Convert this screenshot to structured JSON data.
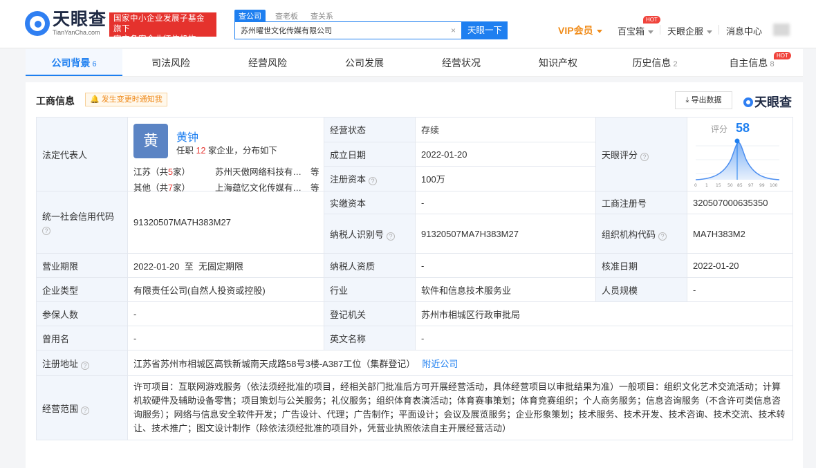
{
  "header": {
    "logo_text": "天眼查",
    "logo_sub": "TianYanCha.com",
    "badge_line1": "国家中小企业发展子基金旗下",
    "badge_line2": "官方备案企业征信机构",
    "search_tabs": [
      "查公司",
      "查老板",
      "查关系"
    ],
    "search_value": "苏州曜世文化传媒有限公司",
    "search_button": "天眼一下",
    "vip": "VIP会员",
    "baobao": "百宝箱",
    "hot": "HOT",
    "qiban": "天眼企服",
    "messages": "消息中心"
  },
  "tabs": [
    {
      "label": "公司背景",
      "count": "6"
    },
    {
      "label": "司法风险",
      "count": ""
    },
    {
      "label": "经营风险",
      "count": ""
    },
    {
      "label": "公司发展",
      "count": ""
    },
    {
      "label": "经营状况",
      "count": ""
    },
    {
      "label": "知识产权",
      "count": ""
    },
    {
      "label": "历史信息",
      "count": "2"
    },
    {
      "label": "自主信息",
      "count": "8"
    }
  ],
  "section": {
    "title": "工商信息",
    "notice": "发生变更时通知我",
    "export": "导出数据",
    "brand": "天眼查"
  },
  "rep": {
    "label": "法定代表人",
    "avatar_char": "黄",
    "name": "黄钟",
    "sub_prefix": "任职",
    "sub_count": "12",
    "sub_suffix": "家企业，分布如下",
    "rows": [
      {
        "region": "江苏（共",
        "count": "5",
        "suffix": "家）",
        "company": "苏州天傲网络科技有…",
        "more": "等"
      },
      {
        "region": "其他（共",
        "count": "7",
        "suffix": "家）",
        "company": "上海蕴忆文化传媒有…",
        "more": "等"
      }
    ]
  },
  "fields": {
    "status_label": "经营状态",
    "status": "存续",
    "founded_label": "成立日期",
    "founded": "2022-01-20",
    "capital_label": "注册资本",
    "capital": "100万",
    "paid_label": "实缴资本",
    "paid": "-",
    "score_label": "天眼评分",
    "score_word": "评分",
    "score": "58",
    "score_ticks": [
      "0",
      "1",
      "15",
      "50",
      "85",
      "97",
      "99",
      "100"
    ],
    "regno_label": "工商注册号",
    "regno": "320507000635350",
    "credit_label": "统一社会信用代码",
    "credit": "91320507MA7H383M27",
    "taxid_label": "纳税人识别号",
    "taxid": "91320507MA7H383M27",
    "org_label": "组织机构代码",
    "org": "MA7H383M2",
    "term_label": "营业期限",
    "term": "2022-01-20  至  无固定期限",
    "taxq_label": "纳税人资质",
    "taxq": "-",
    "approve_label": "核准日期",
    "approve": "2022-01-20",
    "type_label": "企业类型",
    "type": "有限责任公司(自然人投资或控股)",
    "industry_label": "行业",
    "industry": "软件和信息技术服务业",
    "staff_label": "人员规模",
    "staff": "-",
    "insured_label": "参保人数",
    "insured": "-",
    "authority_label": "登记机关",
    "authority": "苏州市相城区行政审批局",
    "former_label": "曾用名",
    "former": "-",
    "english_label": "英文名称",
    "english": "-",
    "address_label": "注册地址",
    "address": "江苏省苏州市相城区高铁新城南天成路58号3楼-A387工位（集群登记）",
    "nearby": "附近公司",
    "scope_label": "经营范围",
    "scope": "许可项目：互联网游戏服务（依法须经批准的项目，经相关部门批准后方可开展经营活动，具体经营项目以审批结果为准）一般项目：组织文化艺术交流活动；计算机软硬件及辅助设备零售；项目策划与公关服务；礼仪服务；组织体育表演活动；体育赛事策划；体育竞赛组织；个人商务服务；信息咨询服务（不含许可类信息咨询服务）；网络与信息安全软件开发；广告设计、代理；广告制作；平面设计；会议及展览服务；企业形象策划；技术服务、技术开发、技术咨询、技术交流、技术转让、技术推广；图文设计制作（除依法须经批准的项目外，凭营业执照依法自主开展经营活动）"
  }
}
